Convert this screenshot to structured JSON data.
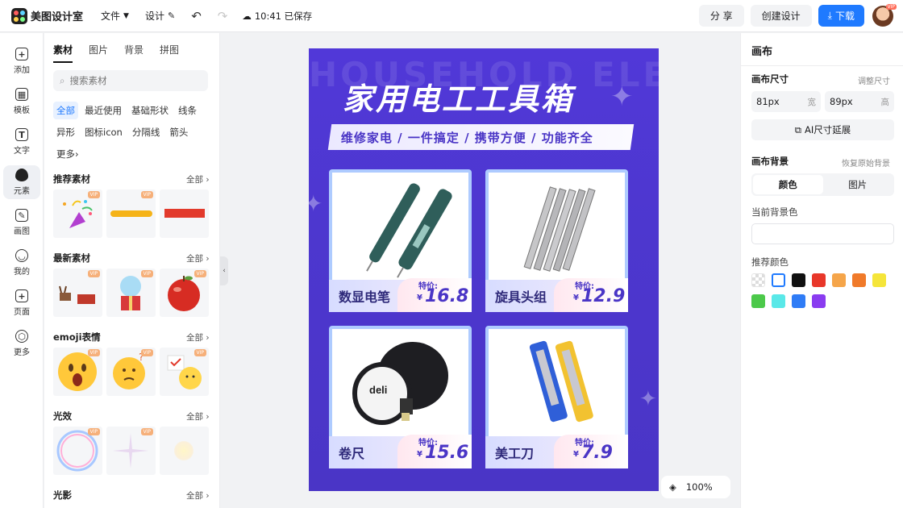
{
  "topbar": {
    "app_name": "美图设计室",
    "menu_file": "文件",
    "menu_design": "设计",
    "save_status": "10:41 已保存",
    "share_label": "分 享",
    "create_label": "创建设计",
    "download_label": "下载",
    "avatar_badge": "VIP"
  },
  "leftnav": {
    "items": [
      {
        "label": "添加",
        "glyph": "+"
      },
      {
        "label": "模板",
        "glyph": "▦"
      },
      {
        "label": "文字",
        "glyph": "T"
      },
      {
        "label": "元素",
        "glyph": ""
      },
      {
        "label": "画图",
        "glyph": "✎"
      },
      {
        "label": "我的",
        "glyph": "◡"
      },
      {
        "label": "页面",
        "glyph": "+"
      },
      {
        "label": "更多",
        "glyph": "⬡"
      }
    ]
  },
  "panel": {
    "tabs": [
      "素材",
      "图片",
      "背景",
      "拼图"
    ],
    "search_placeholder": "搜索素材",
    "chips": [
      "全部",
      "最近使用",
      "基础形状",
      "线条",
      "异形",
      "图标icon",
      "分隔线",
      "箭头",
      "更多"
    ],
    "all_label": "全部",
    "vip": "VIP",
    "sections": [
      "推荐素材",
      "最新素材",
      "emoji表情",
      "光效",
      "光影"
    ]
  },
  "poster": {
    "bg_text": "HOUSEHOLD ELE",
    "title": "家用电工工具箱",
    "subtitle": "维修家电 / 一件搞定 / 携带方便 / 功能齐全",
    "price_label": "特价:",
    "currency": "¥",
    "products": [
      {
        "name": "数显电笔",
        "price": "16.8"
      },
      {
        "name": "旋具头组",
        "price": "12.9"
      },
      {
        "name": "卷尺",
        "price": "15.6"
      },
      {
        "name": "美工刀",
        "price": "7.9"
      }
    ],
    "tape_brand": "deli"
  },
  "zoom": {
    "level": "100%"
  },
  "rpanel": {
    "title": "画布",
    "size_label": "画布尺寸",
    "size_link": "调整尺寸",
    "width_value": "81px",
    "width_unit": "宽",
    "height_value": "89px",
    "height_unit": "高",
    "ai_extend": "AI尺寸延展",
    "bg_label": "画布背景",
    "bg_reset": "恢复原始背景",
    "seg_color": "颜色",
    "seg_image": "图片",
    "current_bg": "当前背景色",
    "recommend": "推荐颜色",
    "swatches": [
      "transparent",
      "#ffffff",
      "#111111",
      "#e8372a",
      "#f5a54a",
      "#f07a2a",
      "#f5e53a",
      "#4cc94a",
      "#5ae8e8",
      "#2f7cf6",
      "#8a3cf0"
    ]
  }
}
